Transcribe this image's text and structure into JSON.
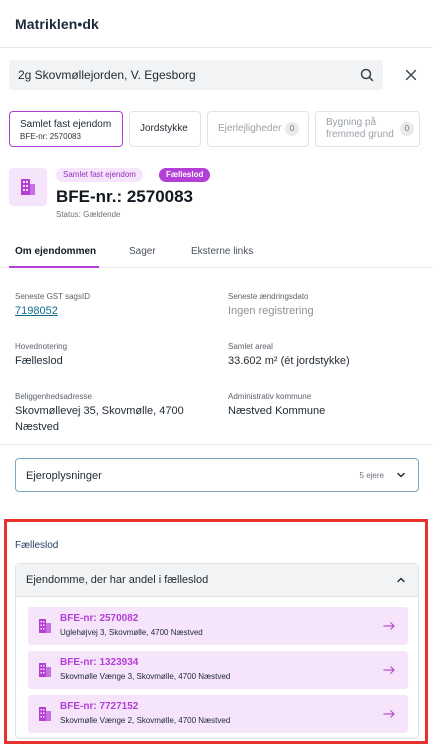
{
  "header": {
    "logo": "Matriklen•dk"
  },
  "search": {
    "value": "2g   Skovmøllejorden, V. Egesborg"
  },
  "type_tabs": [
    {
      "label": "Samlet fast ejendom",
      "sub": "BFE-nr: 2570083"
    },
    {
      "label": "Jordstykke"
    },
    {
      "label": "Ejerlejligheder",
      "count": "0"
    },
    {
      "label": "Bygning på fremmed grund",
      "count": "0"
    }
  ],
  "property": {
    "pill_type": "Samlet fast ejendom",
    "pill_tag": "Fælleslod",
    "title": "BFE-nr.: 2570083",
    "status": "Status: Gældende"
  },
  "content_tabs": [
    "Om ejendommen",
    "Sager",
    "Eksterne links"
  ],
  "fields": {
    "gst_label": "Seneste GST sagsID",
    "gst_value": "7198052",
    "change_label": "Seneste ændringsdato",
    "change_value": "Ingen registrering",
    "main_label": "Hovednotering",
    "main_value": "Fælleslod",
    "area_label": "Samlet areal",
    "area_value": "33.602 m² (ét jordstykke)",
    "address_label": "Beliggenhedsadresse",
    "address_line1": "Skovmøllevej 35, Skovmølle, 4700",
    "address_line2": "Næstved",
    "municipality_label": "Administrativ kommune",
    "municipality_value": "Næstved Kommune"
  },
  "owners": {
    "label": "Ejeroplysninger",
    "count": "5 ejere"
  },
  "faelleslod": {
    "section_label": "Fælleslod",
    "accordion_label": "Ejendomme, der har andel i fælleslod",
    "items": [
      {
        "bfe": "BFE-nr: 2570082",
        "address": "Uglehøjvej 3, Skovmølle, 4700 Næstved"
      },
      {
        "bfe": "BFE-nr: 1323934",
        "address": "Skovmølle Vænge 3, Skovmølle, 4700 Næstved"
      },
      {
        "bfe": "BFE-nr: 7727152",
        "address": "Skovmølle Vænge 2, Skovmølle, 4700 Næstved"
      }
    ]
  },
  "colors": {
    "accent": "#b43fd6",
    "accent_light": "#f6e4fa",
    "link": "#0d6a8c",
    "highlight": "#e5322d"
  }
}
